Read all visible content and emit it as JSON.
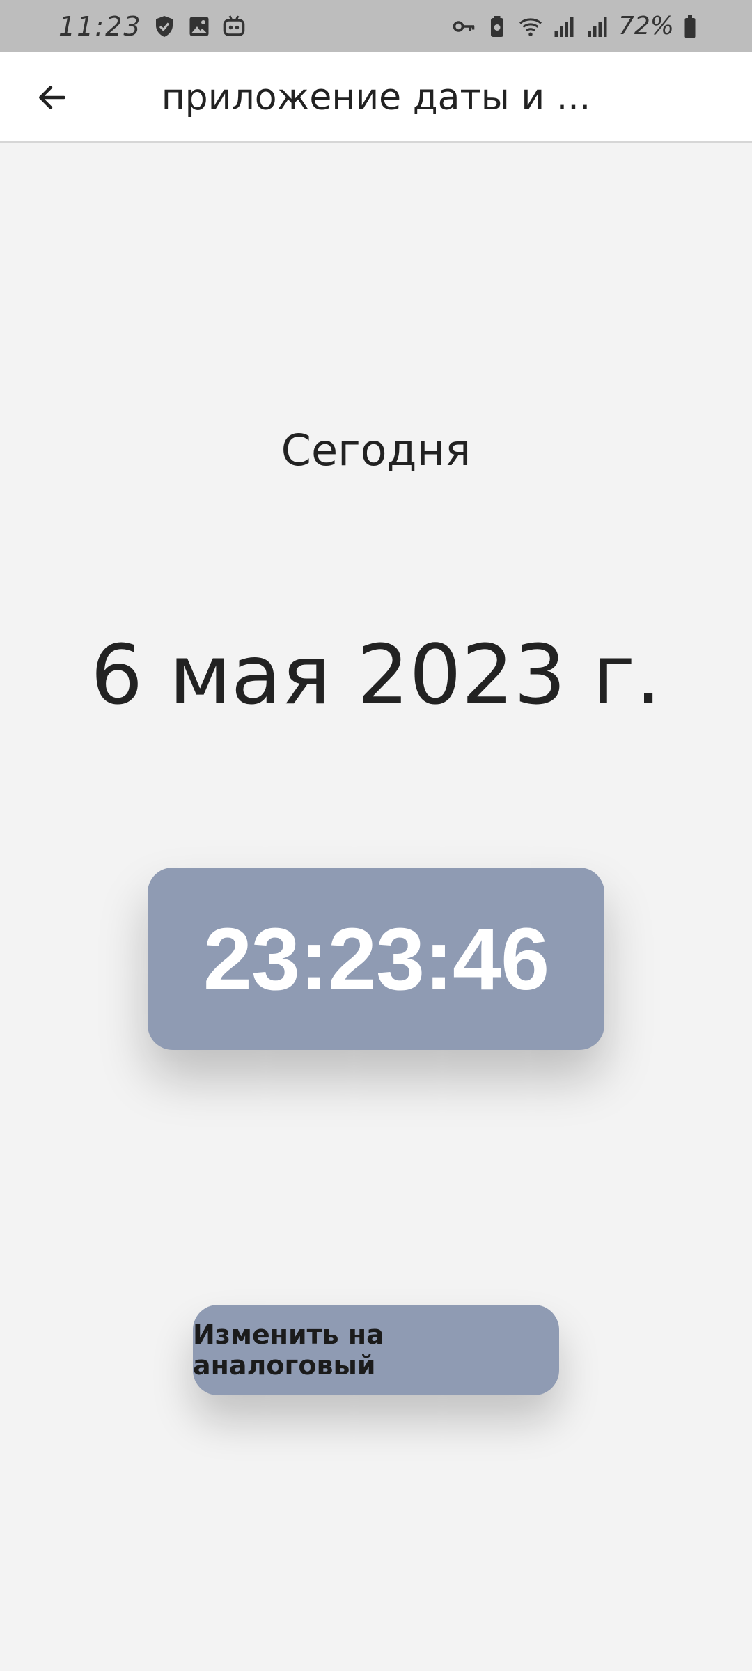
{
  "status_bar": {
    "time": "11:23",
    "battery": "72%",
    "left_icons": [
      "check-shield-icon",
      "image-icon",
      "robot-icon"
    ],
    "right_icons": [
      "key-icon",
      "battery-saver-icon",
      "wifi-icon",
      "signal-icon",
      "signal-icon",
      "battery-icon"
    ]
  },
  "app_bar": {
    "title": "приложение даты и ..."
  },
  "main": {
    "today_label": "Сегодня",
    "date": "6 мая 2023 г.",
    "time": "23:23:46",
    "switch_button_label": "Изменить на аналоговый"
  },
  "colors": {
    "accent": "#8f9bb3",
    "background": "#f3f3f3",
    "status_bar": "#bdbdbd"
  }
}
